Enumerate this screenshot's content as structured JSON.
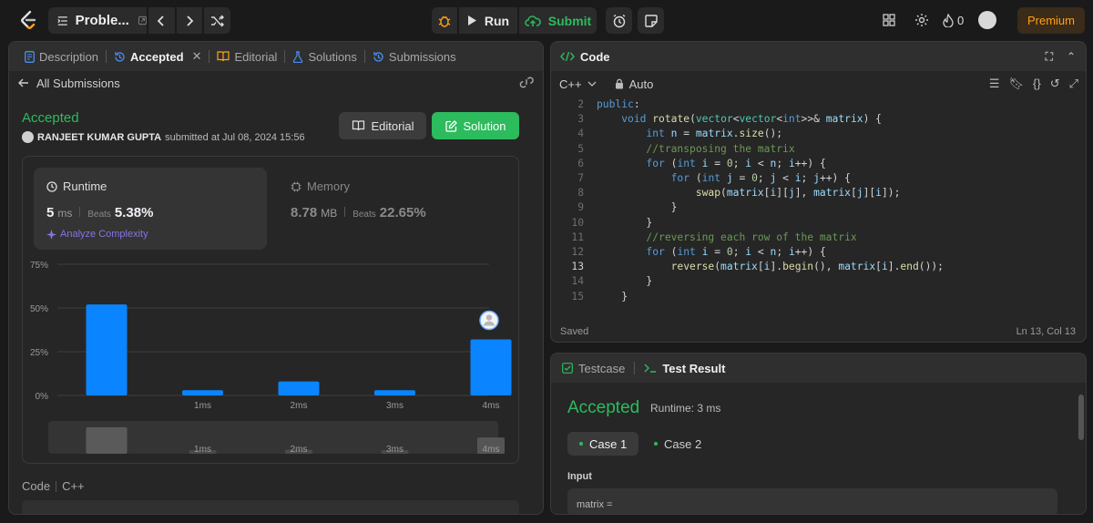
{
  "header": {
    "problem_label": "Proble...",
    "run_label": "Run",
    "submit_label": "Submit",
    "streak_count": "0",
    "premium_label": "Premium"
  },
  "left": {
    "tabs": [
      {
        "label": "Description"
      },
      {
        "label": "Accepted"
      },
      {
        "label": "Editorial"
      },
      {
        "label": "Solutions"
      },
      {
        "label": "Submissions"
      }
    ],
    "back_label": "All Submissions",
    "status": "Accepted",
    "submitter_name": "RANJEET KUMAR GUPTA",
    "submitted_text": "submitted at Jul 08, 2024 15:56",
    "editorial_btn": "Editorial",
    "solution_btn": "Solution",
    "runtime": {
      "title": "Runtime",
      "value": "5",
      "unit": "ms",
      "beats_label": "Beats",
      "beats": "5.38%"
    },
    "analyze_label": "Analyze Complexity",
    "memory": {
      "title": "Memory",
      "value": "8.78",
      "unit": "MB",
      "beats_label": "Beats",
      "beats": "22.65%"
    },
    "code_label": "Code",
    "code_lang": "C++"
  },
  "chart_data": {
    "type": "bar",
    "categories": [
      "",
      "1ms",
      "2ms",
      "3ms",
      "4ms"
    ],
    "values": [
      52,
      3,
      8,
      3,
      32
    ],
    "ylim": [
      0,
      75
    ],
    "yticks": [
      "0%",
      "25%",
      "50%",
      "75%"
    ],
    "ytick_values": [
      0,
      25,
      50,
      75
    ],
    "grid": true,
    "highlight_index": 4,
    "overview_categories": [
      "",
      "1ms",
      "2ms",
      "3ms",
      "4ms"
    ]
  },
  "editor": {
    "title": "Code",
    "language": "C++",
    "mode": "Auto",
    "status": "Saved",
    "cursor": "Ln 13, Col 13",
    "current_line": 13,
    "lines": [
      {
        "n": "2",
        "text": "public:"
      },
      {
        "n": "3",
        "text": "    void rotate(vector<vector<int>>& matrix) {"
      },
      {
        "n": "4",
        "text": "        int n = matrix.size();"
      },
      {
        "n": "5",
        "text": "        //transposing the matrix"
      },
      {
        "n": "6",
        "text": "        for (int i = 0; i < n; i++) {"
      },
      {
        "n": "7",
        "text": "            for (int j = 0; j < i; j++) {"
      },
      {
        "n": "8",
        "text": "                swap(matrix[i][j], matrix[j][i]);"
      },
      {
        "n": "9",
        "text": "            }"
      },
      {
        "n": "10",
        "text": "        }"
      },
      {
        "n": "11",
        "text": "        //reversing each row of the matrix"
      },
      {
        "n": "12",
        "text": "        for (int i = 0; i < n; i++) {"
      },
      {
        "n": "13",
        "text": "            reverse(matrix[i].begin(), matrix[i].end());"
      },
      {
        "n": "14",
        "text": "        }"
      },
      {
        "n": "15",
        "text": "    }"
      }
    ]
  },
  "test": {
    "tab_testcase": "Testcase",
    "tab_result": "Test Result",
    "status": "Accepted",
    "runtime": "Runtime: 3 ms",
    "cases": [
      "Case 1",
      "Case 2"
    ],
    "input_label": "Input",
    "input_var": "matrix ="
  },
  "colors": {
    "accent_green": "#2cbb5d",
    "bar_blue": "#0a84ff",
    "premium_orange": "#ffa116"
  }
}
